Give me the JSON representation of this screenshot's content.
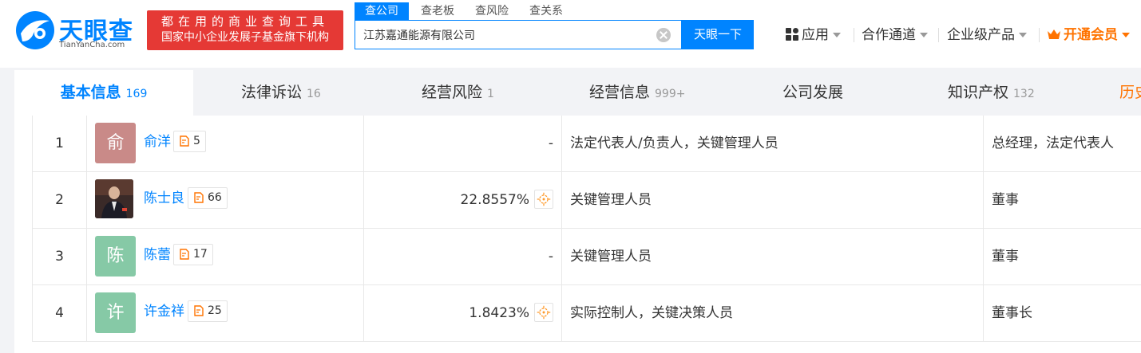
{
  "header": {
    "logo_text": "天眼查",
    "logo_sub": "TianYanCha.com",
    "slogan_line1": "都在用的商业查询工具",
    "slogan_line2": "国家中小企业发展子基金旗下机构",
    "search_tabs": [
      "查公司",
      "查老板",
      "查风险",
      "查关系"
    ],
    "search_value": "江苏嘉通能源有限公司",
    "search_button": "天眼一下",
    "nav": {
      "apps": "应用",
      "partner": "合作通道",
      "enterprise": "企业级产品",
      "vip": "开通会员"
    }
  },
  "tabs": [
    {
      "label": "基本信息",
      "count": "169"
    },
    {
      "label": "法律诉讼",
      "count": "16"
    },
    {
      "label": "经营风险",
      "count": "1"
    },
    {
      "label": "经营信息",
      "count": "999+"
    },
    {
      "label": "公司发展",
      "count": ""
    },
    {
      "label": "知识产权",
      "count": "132"
    },
    {
      "label": "历史",
      "count": ""
    }
  ],
  "rows": [
    {
      "index": "1",
      "avatar_char": "俞",
      "avatar_color": "#c98a88",
      "name": "俞洋",
      "badge": "5",
      "ratio": "-",
      "role": "法定代表人/负责人，关键管理人员",
      "title": "总经理，法定代表人"
    },
    {
      "index": "2",
      "avatar_char": "",
      "avatar_color": "#2a2020",
      "name": "陈士良",
      "badge": "66",
      "ratio": "22.8557%",
      "role": "关键管理人员",
      "title": "董事"
    },
    {
      "index": "3",
      "avatar_char": "陈",
      "avatar_color": "#86c9a6",
      "name": "陈蕾",
      "badge": "17",
      "ratio": "-",
      "role": "关键管理人员",
      "title": "董事"
    },
    {
      "index": "4",
      "avatar_char": "许",
      "avatar_color": "#86c9a6",
      "name": "许金祥",
      "badge": "25",
      "ratio": "1.8423%",
      "role": "实际控制人，关键决策人员",
      "title": "董事长"
    }
  ],
  "colors": {
    "brand": "#0084ff",
    "vip": "#ff7300",
    "slogan_bg": "#e53935"
  }
}
